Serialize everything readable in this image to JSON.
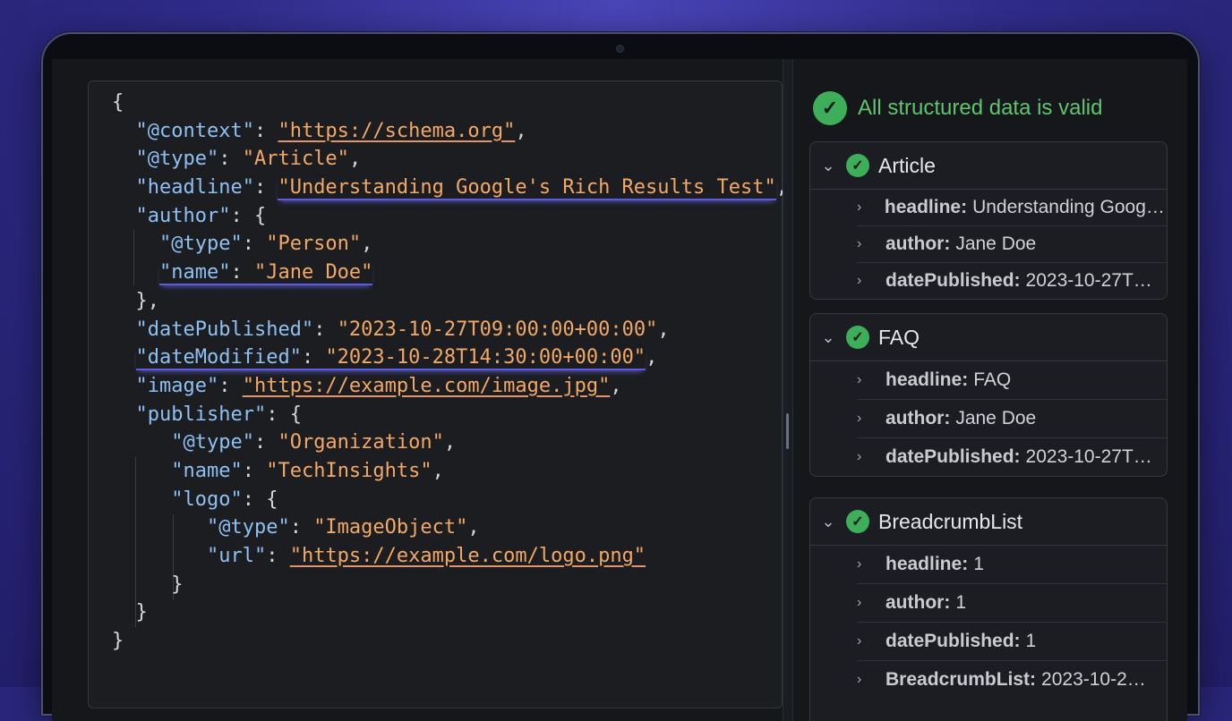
{
  "code": {
    "lines": [
      [
        {
          "t": "{",
          "c": "p"
        }
      ],
      [
        {
          "t": "  ",
          "c": "p"
        },
        {
          "t": "\"@context\"",
          "c": "k"
        },
        {
          "t": ": ",
          "c": "p"
        },
        {
          "t": "\"https://schema.org\"",
          "c": "s u"
        },
        {
          "t": ",",
          "c": "p"
        }
      ],
      [
        {
          "t": "  ",
          "c": "p"
        },
        {
          "t": "\"@type\"",
          "c": "k"
        },
        {
          "t": ": ",
          "c": "p"
        },
        {
          "t": "\"Article\"",
          "c": "s"
        },
        {
          "t": ",",
          "c": "p"
        }
      ],
      [
        {
          "t": "  ",
          "c": "p"
        },
        {
          "t": "\"headline\"",
          "c": "k"
        },
        {
          "t": ": ",
          "c": "p"
        },
        {
          "t": "\"Understanding Google's Rich Results Test\"",
          "c": "s hl"
        },
        {
          "t": ",",
          "c": "p"
        }
      ],
      [
        {
          "t": "  ",
          "c": "p"
        },
        {
          "t": "\"author\"",
          "c": "k"
        },
        {
          "t": ": {",
          "c": "p"
        }
      ],
      [
        {
          "t": "    ",
          "c": "p"
        },
        {
          "t": "\"@type\"",
          "c": "k"
        },
        {
          "t": ": ",
          "c": "p"
        },
        {
          "t": "\"Person\"",
          "c": "s"
        },
        {
          "t": ",",
          "c": "p"
        }
      ],
      [
        {
          "t": "    ",
          "c": "p"
        },
        {
          "t": "\"name\": \"Jane Doe\"",
          "c": "k hlw"
        }
      ],
      [
        {
          "t": "  },",
          "c": "p"
        }
      ],
      [
        {
          "t": "  ",
          "c": "p"
        },
        {
          "t": "\"datePublished\"",
          "c": "k"
        },
        {
          "t": ": ",
          "c": "p"
        },
        {
          "t": "\"2023-10-27T09:00:00+00:00\"",
          "c": "s"
        },
        {
          "t": ",",
          "c": "p"
        }
      ],
      [
        {
          "t": "  ",
          "c": "p"
        },
        {
          "t": "\"dateModified\": \"2023-10-28T14:30:00+00:00\"",
          "c": "k hlm"
        },
        {
          "t": ",",
          "c": "p"
        }
      ],
      [
        {
          "t": "  ",
          "c": "p"
        },
        {
          "t": "\"image\"",
          "c": "k"
        },
        {
          "t": ": ",
          "c": "p"
        },
        {
          "t": "\"https://example.com/image.jpg\"",
          "c": "s u"
        },
        {
          "t": ",",
          "c": "p"
        }
      ],
      [
        {
          "t": "  ",
          "c": "p"
        },
        {
          "t": "\"publisher\"",
          "c": "k"
        },
        {
          "t": ": {",
          "c": "p"
        }
      ],
      [
        {
          "t": "     ",
          "c": "p"
        },
        {
          "t": "\"@type\"",
          "c": "k"
        },
        {
          "t": ": ",
          "c": "p"
        },
        {
          "t": "\"Organization\"",
          "c": "s"
        },
        {
          "t": ",",
          "c": "p"
        }
      ],
      [
        {
          "t": "     ",
          "c": "p"
        },
        {
          "t": "\"name\"",
          "c": "k"
        },
        {
          "t": ": ",
          "c": "p"
        },
        {
          "t": "\"TechInsights\"",
          "c": "s"
        },
        {
          "t": ",",
          "c": "p"
        }
      ],
      [
        {
          "t": "     ",
          "c": "p"
        },
        {
          "t": "\"logo\"",
          "c": "k"
        },
        {
          "t": ": {",
          "c": "p"
        }
      ],
      [
        {
          "t": "        ",
          "c": "p"
        },
        {
          "t": "\"@type\"",
          "c": "k"
        },
        {
          "t": ": ",
          "c": "p"
        },
        {
          "t": "\"ImageObject\"",
          "c": "s"
        },
        {
          "t": ",",
          "c": "p"
        }
      ],
      [
        {
          "t": "        ",
          "c": "p"
        },
        {
          "t": "\"url\"",
          "c": "k"
        },
        {
          "t": ": ",
          "c": "p"
        },
        {
          "t": "\"https://example.com/logo.png\"",
          "c": "s u"
        }
      ],
      [
        {
          "t": "     }",
          "c": "p"
        }
      ],
      [
        {
          "t": "  }",
          "c": "p"
        }
      ],
      [
        {
          "t": "}",
          "c": "p"
        }
      ]
    ]
  },
  "results": {
    "status_text": "All structured data is valid",
    "cards": [
      {
        "title": "Article",
        "rows": [
          {
            "key": "headline:",
            "value": "Understanding Google's"
          },
          {
            "key": "author:",
            "value": "Jane Doe"
          },
          {
            "key": "datePublished:",
            "value": "2023-10-27T…"
          }
        ]
      },
      {
        "title": "FAQ",
        "rows": [
          {
            "key": "headline:",
            "value": "FAQ"
          },
          {
            "key": "author:",
            "value": "Jane Doe"
          },
          {
            "key": "datePublished:",
            "value": "2023-10-27T…"
          }
        ]
      },
      {
        "title": "BreadcrumbList",
        "rows": [
          {
            "key": "headline:",
            "value": "1"
          },
          {
            "key": "author:",
            "value": "1"
          },
          {
            "key": "datePublished:",
            "value": "1"
          },
          {
            "key": "BreadcrumbList:",
            "value": "2023-10-2…"
          }
        ]
      }
    ]
  },
  "icons": {
    "status": "check-circle-icon",
    "card_check": "check-circle-icon",
    "collapse": "chevron-down-icon",
    "expand_row": "chevron-right-icon"
  }
}
